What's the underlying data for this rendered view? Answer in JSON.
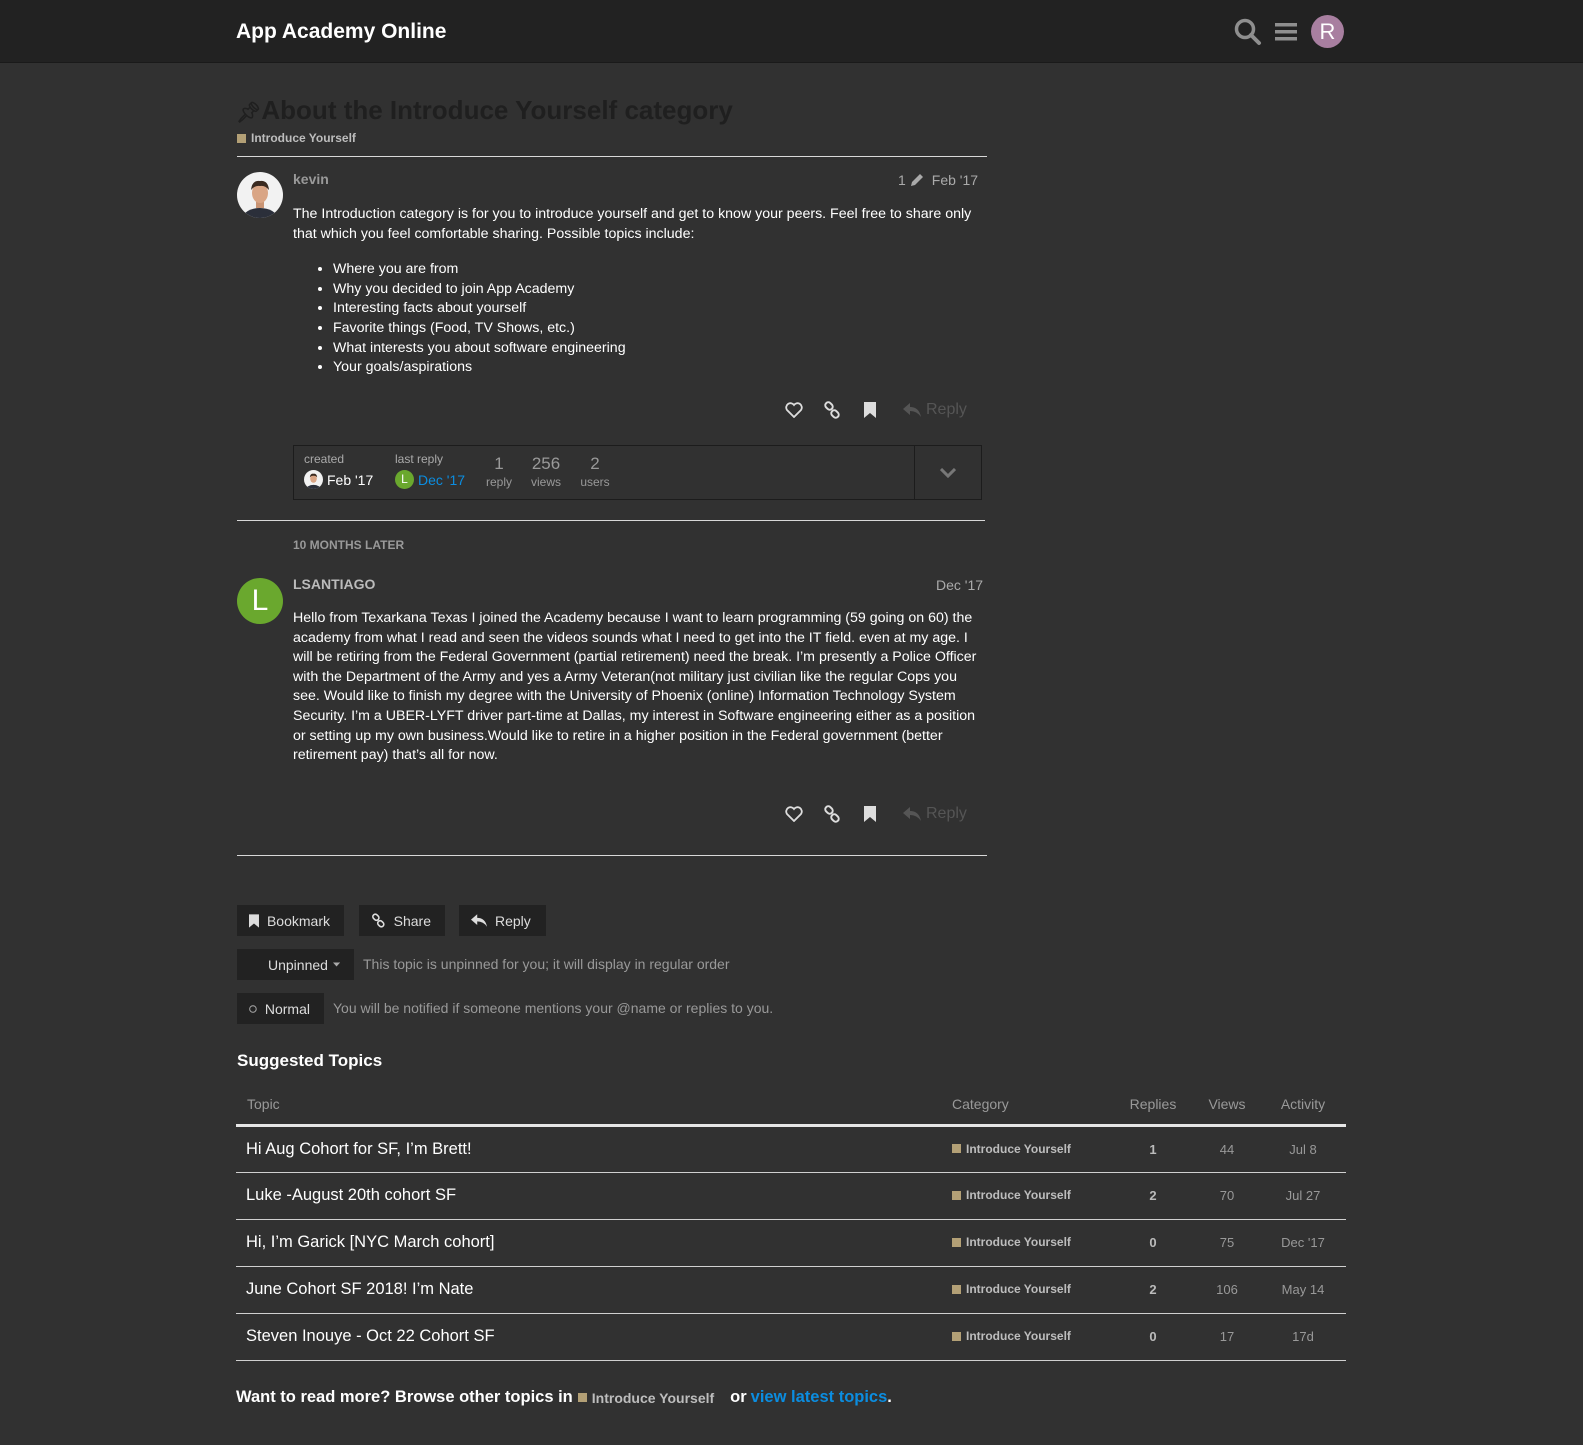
{
  "header": {
    "site_title": "App Academy Online",
    "user_initial": "R"
  },
  "topic": {
    "title": "About the Introduce Yourself category",
    "category": "Introduce Yourself",
    "category_color": "#b3a076"
  },
  "post1": {
    "username": "kevin",
    "edits": "1",
    "date": "Feb '17",
    "body_intro": "The Introduction category is for you to introduce yourself and get to know your peers. Feel free to share only that which you feel comfortable sharing. Possible topics include:",
    "items": [
      "Where you are from",
      "Why you decided to join App Academy",
      "Interesting facts about yourself",
      "Favorite things (Food, TV Shows, etc.)",
      "What interests you about software engineering",
      "Your goals/aspirations"
    ],
    "reply_label": "Reply"
  },
  "topic_map": {
    "created_label": "created",
    "created_date": "Feb '17",
    "last_reply_label": "last reply",
    "last_reply_date": "Dec '17",
    "last_reply_initial": "L",
    "replies": "1",
    "replies_label": "reply",
    "views": "256",
    "views_label": "views",
    "users": "2",
    "users_label": "users"
  },
  "time_gap": "10 MONTHS LATER",
  "post2": {
    "username": "LSANTIAGO",
    "initial": "L",
    "avatar_color": "#6aa82e",
    "date": "Dec '17",
    "body": "Hello from Texarkana Texas I joined the Academy because I want to learn programming (59 going on 60) the academy from what I read and seen the videos sounds what I need to get into the IT field. even at my age. I will be retiring from the Federal Government (partial retirement) need the break. I’m presently a Police Officer with the Department of the Army and yes a Army Veteran(not military just civilian like the regular Cops you see. Would like to finish my degree with the University of Phoenix (online) Information Technology System Security. I’m a UBER-LYFT driver part-time at Dallas, my interest in Software engineering either as a position or setting up my own business.Would like to retire in a higher position in the Federal government (better retirement pay) that’s all for now.",
    "reply_label": "Reply"
  },
  "footer_buttons": {
    "bookmark": "Bookmark",
    "share": "Share",
    "reply": "Reply"
  },
  "pin": {
    "label": "Unpinned",
    "note": "This topic is unpinned for you; it will display in regular order"
  },
  "notification": {
    "label": "Normal",
    "note": "You will be notified if someone mentions your @name or replies to you."
  },
  "suggested": {
    "title": "Suggested Topics",
    "headers": {
      "topic": "Topic",
      "category": "Category",
      "replies": "Replies",
      "views": "Views",
      "activity": "Activity"
    },
    "rows": [
      {
        "title": "Hi Aug Cohort for SF, I’m Brett!",
        "category": "Introduce Yourself",
        "replies": "1",
        "views": "44",
        "activity": "Jul 8"
      },
      {
        "title": "Luke -August 20th cohort SF",
        "category": "Introduce Yourself",
        "replies": "2",
        "views": "70",
        "activity": "Jul 27"
      },
      {
        "title": "Hi, I’m Garick [NYC March cohort]",
        "category": "Introduce Yourself",
        "replies": "0",
        "views": "75",
        "activity": "Dec '17"
      },
      {
        "title": "June Cohort SF 2018! I’m Nate",
        "category": "Introduce Yourself",
        "replies": "2",
        "views": "106",
        "activity": "May 14"
      },
      {
        "title": "Steven Inouye - Oct 22 Cohort SF",
        "category": "Introduce Yourself",
        "replies": "0",
        "views": "17",
        "activity": "17d"
      }
    ]
  },
  "read_more": {
    "prefix": "Want to read more? Browse other topics in",
    "category": "Introduce Yourself",
    "or": "or",
    "link": "view latest topics",
    "suffix": "."
  }
}
